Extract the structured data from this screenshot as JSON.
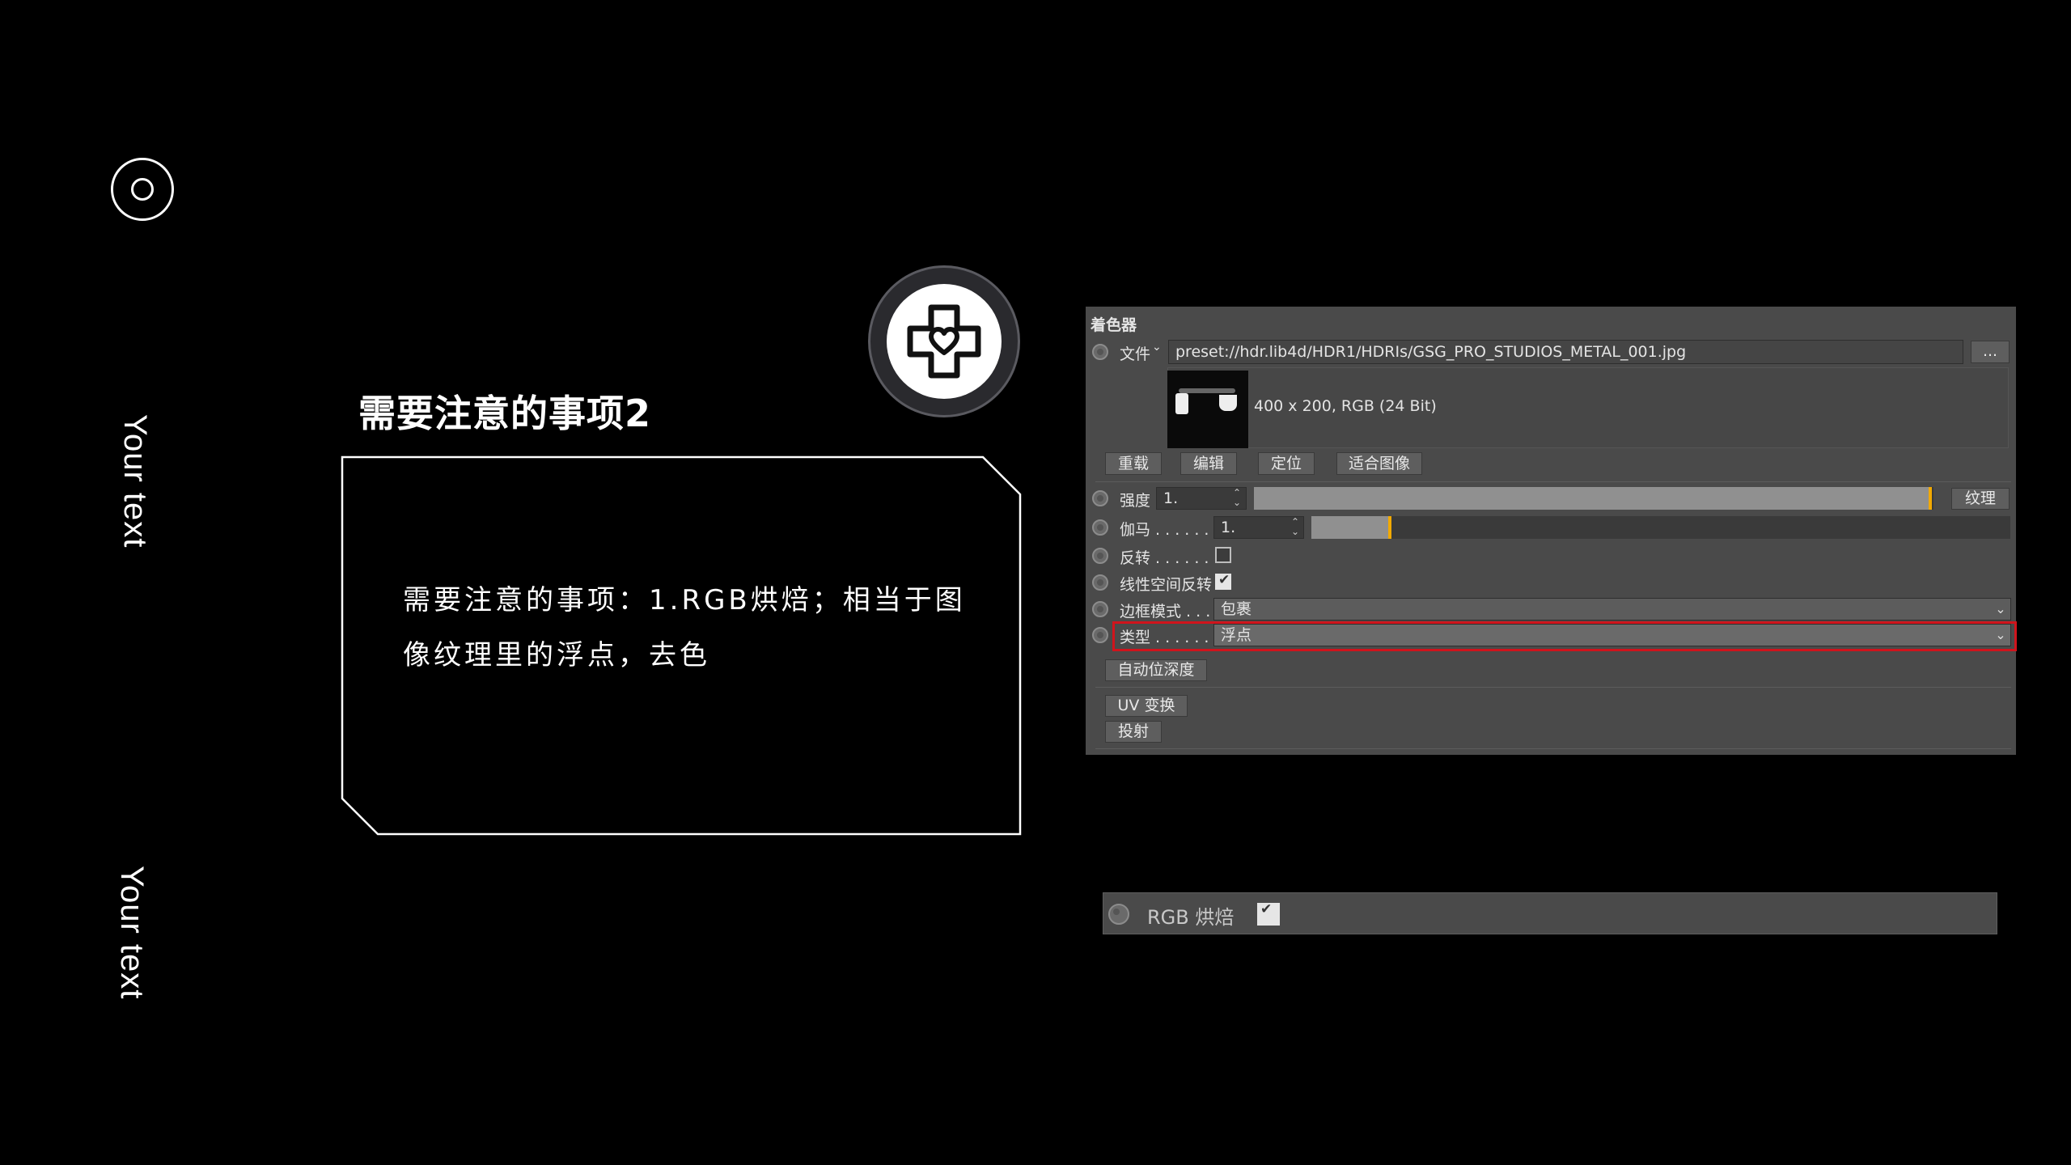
{
  "left": {
    "vertical_text_1": "Your text",
    "vertical_text_2": "Your text"
  },
  "title": "需要注意的事项2",
  "box_text": "需要注意的事项：1.RGB烘焙；相当于图像纹理里的浮点，去色",
  "panel": {
    "section": "着色器",
    "file_label": "文件",
    "file_path": "preset://hdr.lib4d/HDR1/HDRIs/GSG_PRO_STUDIOS_METAL_001.jpg",
    "browse_label": "...",
    "image_info": "400 x 200, RGB (24 Bit)",
    "buttons": [
      "重载",
      "编辑",
      "定位",
      "适合图像"
    ],
    "intensity_label": "强度",
    "intensity_value": "1.",
    "intensity_fill": 1.0,
    "texture_btn": "纹理",
    "gamma_label": "伽马 . . . . . .",
    "gamma_value": "1.",
    "gamma_fill": 0.11,
    "invert_label": "反转 . . . . . .",
    "invert_checked": false,
    "linear_label": "线性空间反转",
    "linear_checked": true,
    "border_label": "边框模式 . . .",
    "border_value": "包裹",
    "type_label": "类型 . . . . . .",
    "type_value": "浮点",
    "auto_depth_btn": "自动位深度",
    "uv_btn": "UV 变换",
    "projection_btn": "投射",
    "highlight_color": "#d0141c"
  },
  "rgb_bake": {
    "label": "RGB 烘焙",
    "checked": true
  }
}
